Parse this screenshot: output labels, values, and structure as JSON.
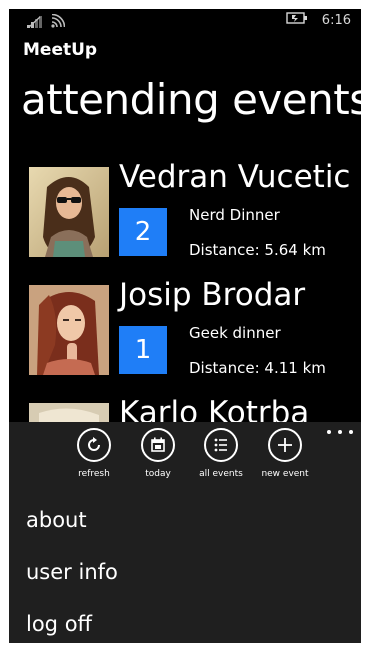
{
  "status_bar": {
    "time": "6:16",
    "icons": [
      "signal-icon",
      "wifi-icon",
      "battery-icon"
    ]
  },
  "app": {
    "title": "MeetUp"
  },
  "page": {
    "title": "attending events"
  },
  "events": [
    {
      "name": "Vedran Vucetic",
      "count": "2",
      "type": "Nerd Dinner",
      "distance": "Distance: 5.64 km"
    },
    {
      "name": "Josip Brodar",
      "count": "1",
      "type": "Geek dinner",
      "distance": "Distance: 4.11 km"
    },
    {
      "name": "Karlo Kotrba",
      "count": "",
      "type": "",
      "distance": ""
    }
  ],
  "app_bar": {
    "buttons": [
      {
        "label": "refresh",
        "icon": "refresh-icon"
      },
      {
        "label": "today",
        "icon": "calendar-icon"
      },
      {
        "label": "all events",
        "icon": "list-icon"
      },
      {
        "label": "new event",
        "icon": "add-icon"
      }
    ],
    "more_icon": "ellipsis-icon"
  },
  "menu": {
    "items": [
      "about",
      "user info",
      "log off"
    ]
  },
  "colors": {
    "accent": "#1f7ef7",
    "background": "#000000",
    "app_bar": "#1f1f1f",
    "text": "#ffffff"
  }
}
